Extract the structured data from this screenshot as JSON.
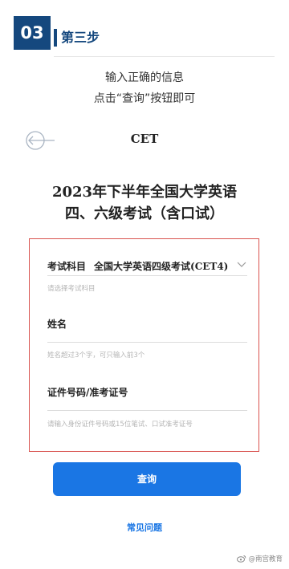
{
  "step": {
    "number": "03",
    "title": "第三步"
  },
  "instructions": {
    "line1": "输入正确的信息",
    "line2": "点击“查询”按钮即可"
  },
  "header": {
    "cet_title": "CET"
  },
  "exam": {
    "title_line1": "2023年下半年全国大学英语",
    "title_line2": "四、六级考试（含口试）"
  },
  "form": {
    "subject_label": "考试科目",
    "subject_value": "全国大学英语四级考试(CET4)",
    "subject_hint": "请选择考试科目",
    "name_label": "姓名",
    "name_hint": "姓名超过3个字，可只输入前3个",
    "id_label": "证件号码/准考证号",
    "id_hint": "请输入身份证件号码或15位笔试、口试准考证号"
  },
  "buttons": {
    "query_label": "查询",
    "faq_label": "常见问题"
  },
  "watermark": {
    "text": "@南宫教育"
  },
  "colors": {
    "brand_navy": "#15487e",
    "accent_blue": "#1a76e4",
    "highlight_red": "#d9534f"
  }
}
